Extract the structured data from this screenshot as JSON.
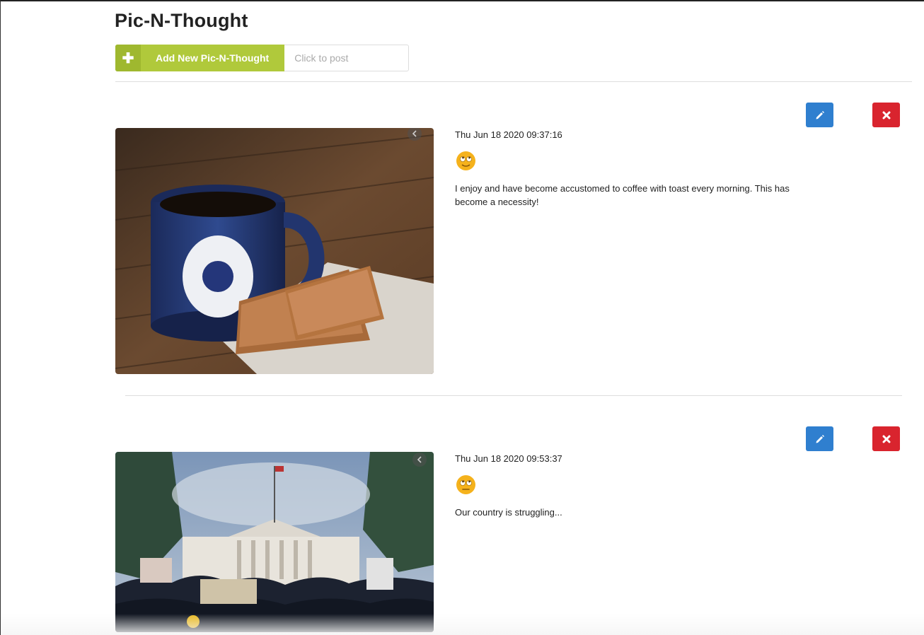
{
  "page": {
    "title": "Pic-N-Thought"
  },
  "add_bar": {
    "button_icon": "plus-icon",
    "button_label": "Add New Pic-N-Thought",
    "input_placeholder": "Click to post",
    "accent": "#b0c93b"
  },
  "posts": [
    {
      "timestamp": "Thu Jun 18 2020 09:37:16",
      "mood_icon": "rolling-eyes-emoji-icon",
      "text": "I enjoy and have become accustomed to coffee with toast every morning. This has become a necessity!",
      "image_icon": "coffee-and-toast-photo",
      "edit_icon": "pencil-icon",
      "delete_icon": "close-x-icon"
    },
    {
      "timestamp": "Thu Jun 18 2020 09:53:37",
      "mood_icon": "eye-roll-neutral-emoji-icon",
      "text": "Our country is struggling...",
      "image_icon": "white-house-protest-photo",
      "edit_icon": "pencil-icon",
      "delete_icon": "close-x-icon"
    }
  ],
  "colors": {
    "edit": "#2f7fcf",
    "delete": "#d9242e",
    "emoji": "#f5b21c"
  }
}
